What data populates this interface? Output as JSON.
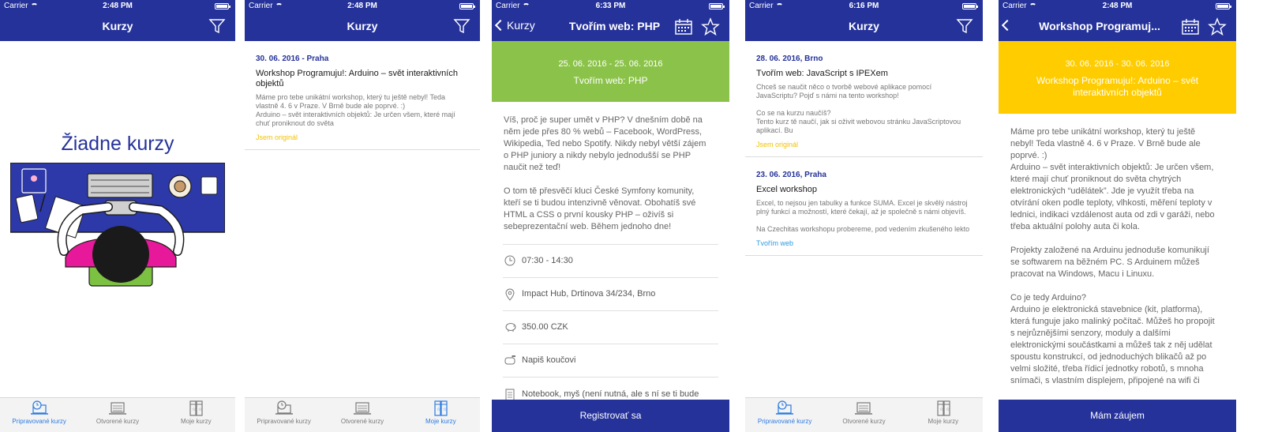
{
  "status": {
    "carrier": "Carrier",
    "s1_time": "2:48 PM",
    "s2_time": "2:48 PM",
    "s3_time": "6:33 PM",
    "s4_time": "6:16 PM",
    "s5_time": "2:48 PM"
  },
  "tabs": {
    "prepared": "Pripravované kurzy",
    "opened": "Otvorené kurzy",
    "mine": "Moje kurzy"
  },
  "screen1": {
    "title": "Kurzy",
    "empty_label": "Žiadne kurzy"
  },
  "screen2": {
    "title": "Kurzy",
    "items": [
      {
        "date": "30. 06. 2016 - Praha",
        "name": "Workshop Programuju!: Arduino – svět interaktivních objektů",
        "desc": "Máme pro tebe unikátní workshop, který tu ještě nebyl! Teda vlastně 4. 6 v Praze. V Brně bude ale poprvé. :)\n Arduino – svět interaktivních objektů: Je určen všem, které mají chuť proniknout do světa",
        "tag": "Jsem originál"
      }
    ]
  },
  "screen3": {
    "back": "Kurzy",
    "title": "Tvořím web: PHP",
    "hero_dates": "25. 06. 2016 - 25. 06. 2016",
    "hero_title": "Tvořím web: PHP",
    "body": "Víš, proč je super umět v PHP? V dnešním době na něm jede přes 80 % webů – Facebook, WordPress, Wikipedia, Ted nebo Spotify. Nikdy nebyl větší zájem o PHP juniory a nikdy nebylo jednodušší se PHP naučit než teď!\n\nO tom tě přesvěčí kluci České Symfony komunity, kteří se ti budou intenzivně věnovat. Obohatíš své HTML a CSS o první kousky PHP – oživíš si sebeprezentační web. Během jednoho dne!",
    "time": "07:30 - 14:30",
    "place": "Impact Hub, Drtinova 34/234, Brno",
    "price": "350.00 CZK",
    "coach": "Napiš koučovi",
    "notes": "Notebook, myš (není nutná, ale s ní se ti bude pracovat lépe), pokud máš za sebou HTML &",
    "button": "Registrovať sa"
  },
  "screen4": {
    "title": "Kurzy",
    "items": [
      {
        "date": "28. 06. 2016, Brno",
        "name": "Tvořím web: JavaScript s IPEXem",
        "desc": "Chceš se naučit něco o tvorbě webové aplikace pomocí JavaScriptu? Pojď s námi na tento workshop!\n\nCo se na kurzu naučíš?\nTento kurz tě naučí, jak si oživit webovou stránku JavaScriptovou aplikací. Bu",
        "tag": "Jsem originál"
      },
      {
        "date": "23. 06. 2016, Praha",
        "name": "Excel workshop",
        "desc": "Excel, to nejsou jen tabulky a funkce SUMA. Excel je skvělý nástroj plný funkcí a možností, které čekají, až je společně s námi objevíš.\n\nNa Czechitas workshopu probereme, pod vedením zkušeného lekto",
        "tag": "Tvořím web"
      }
    ]
  },
  "screen5": {
    "title": "Workshop Programuj...",
    "hero_dates": "30. 06. 2016 - 30. 06. 2016",
    "hero_title": "Workshop Programuju!: Arduino – svět interaktivních objektů",
    "body": "Máme pro tebe unikátní workshop, který tu ještě nebyl! Teda vlastně 4. 6 v Praze. V Brně bude ale poprvé. :)\n Arduino – svět interaktivních objektů: Je určen všem, které mají chuť proniknout do světa chytrých elektronických “udělátek”. Jde je využít třeba na otvírání oken podle teploty, vlhkosti, měření teploty v lednici, indikaci vzdálenost auta od zdi v garáži, nebo třeba aktuální polohy auta či kola.\n\nProjekty založené na Arduinu jednoduše komunikují se softwarem na běžném PC. S Arduinem můžeš pracovat na Windows, Macu i Linuxu.\n\nCo je tedy Arduino?\nArduino je elektronická stavebnice (kit, platforma), která funguje jako malinký počítač. Můžeš ho propojit s nejrůznějšími senzory, moduly a dalšími elektronickými součástkami a můžeš tak z něj udělat spoustu konstrukcí, od jednoduchých blikačů až po velmi složité, třeba řídicí jednotky robotů, s mnoha snímači, s vlastním displejem, připojené na wifi či bluetooth… Stačí jen propojit a naprogramovat v jednoduchém jazyce, který je podobný C, JavaScriptu, Javě, C# atd.\nZákladní sadu seženeš většinou kolem pěti set",
    "button": "Mám záujem"
  },
  "colors": {
    "primary": "#25329a",
    "php_green": "#8bc34a",
    "arduino_yellow": "#ffcc00",
    "tag_yellow": "#f2c200",
    "tag_blue": "#2b9be0",
    "active_tab": "#2b7be0"
  }
}
